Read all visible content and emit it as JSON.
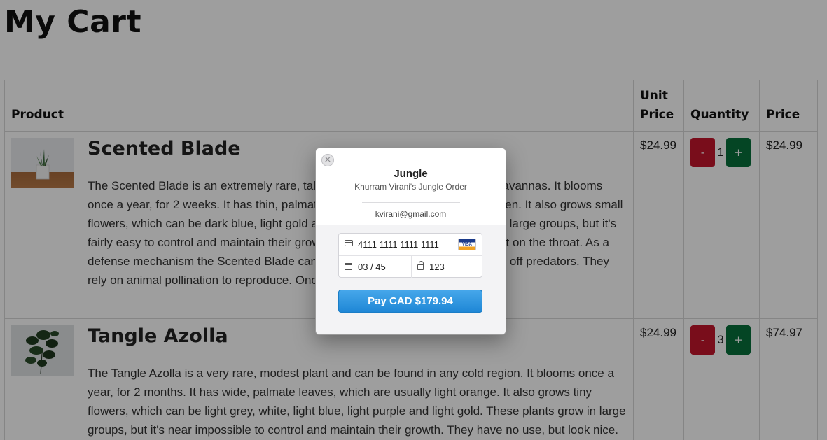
{
  "page": {
    "title": "My Cart"
  },
  "table": {
    "headers": {
      "product": "Product",
      "unit_price": "Unit Price",
      "quantity": "Quantity",
      "price": "Price"
    },
    "rows": [
      {
        "name": "Scented Blade",
        "description": "The Scented Blade is an extremely rare, tall plant and can be found mostly in savannas. It blooms once a year, for 2 weeks. It has thin, palmate leaves, which are usually light green. It also grows small flowers, which can be dark blue, light gold and light green. These plants grow in large groups, but it's fairly easy to control and maintain their growth. They can have an irritating effect on the throat. As a defense mechanism the Scented Blade can collapse its leaves in order to scare off predators. They rely on animal pollination to reproduce. Once pollinated, they produce seeds.",
        "unit_price": "$24.99",
        "qty": "1",
        "price": "$24.99",
        "minus": "-",
        "plus": "+"
      },
      {
        "name": "Tangle Azolla",
        "description": "The Tangle Azolla is a very rare, modest plant and can be found in any cold region. It blooms once a year, for 2 months. It has wide, palmate leaves, which are usually light orange. It also grows tiny flowers, which can be light grey, white, light blue, light purple and light gold. These plants grow in large groups, but it's near impossible to control and maintain their growth. They have no use, but look nice.",
        "unit_price": "$24.99",
        "qty": "3",
        "price": "$74.97",
        "minus": "-",
        "plus": "+"
      }
    ]
  },
  "checkout": {
    "close": "×",
    "title": "Jungle",
    "subtitle": "Khurram Virani's Jungle Order",
    "email": "kvirani@gmail.com",
    "card_number": "4111 1111 1111 1111",
    "card_brand": "VISA",
    "expiry": "03 / 45",
    "cvc": "123",
    "pay_label": "Pay CAD $179.94"
  },
  "colors": {
    "minus_button": "#c4152c",
    "plus_button": "#08703a",
    "pay_button": "#2b90dc",
    "overlay": "rgba(0,0,0,0.38)"
  },
  "icons": [
    "close-icon",
    "credit-card-icon",
    "calendar-icon",
    "lock-icon",
    "visa-logo-icon"
  ]
}
